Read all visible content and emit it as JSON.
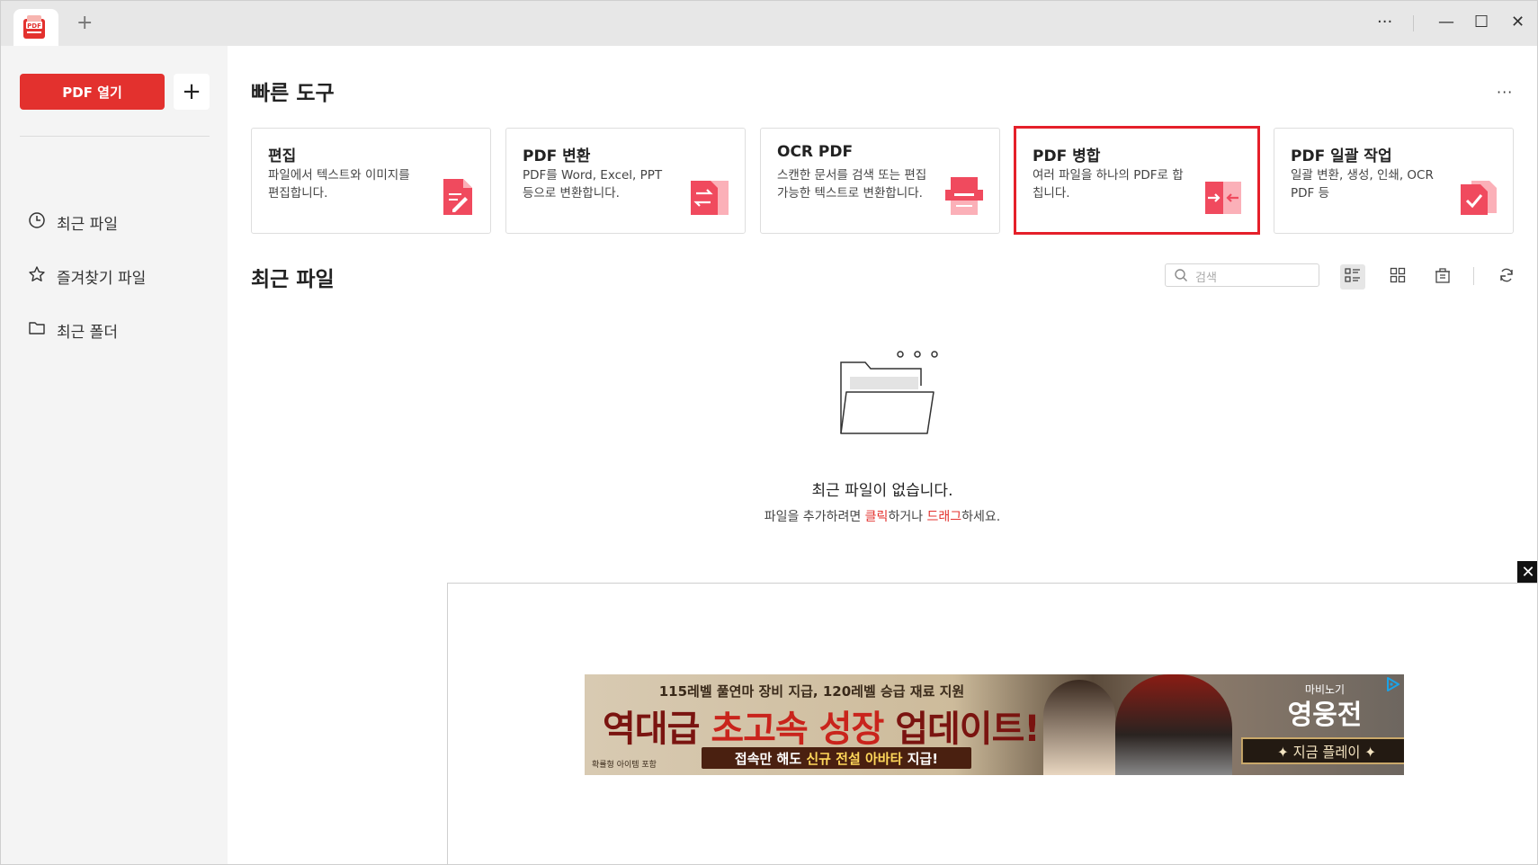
{
  "titlebar": {
    "new_tab": "+",
    "more": "···",
    "minimize": "—",
    "maximize": "☐",
    "close": "✕",
    "logo_text": "PDF"
  },
  "sidebar": {
    "open_button": "PDF 열기",
    "add_button": "+",
    "items": [
      {
        "label": "최근 파일",
        "icon": "clock-icon"
      },
      {
        "label": "즐겨찾기 파일",
        "icon": "star-icon"
      },
      {
        "label": "최근 폴더",
        "icon": "folder-icon"
      }
    ]
  },
  "quick_tools": {
    "title": "빠른 도구",
    "more": "···",
    "cards": [
      {
        "title": "편집",
        "desc": "파일에서 텍스트와 이미지를 편집합니다.",
        "icon": "edit-doc-icon"
      },
      {
        "title": "PDF 변환",
        "desc": "PDF를 Word, Excel, PPT 등으로 변환합니다.",
        "icon": "convert-icon"
      },
      {
        "title": "OCR PDF",
        "desc": "스캔한 문서를 검색 또는 편집 가능한 텍스트로 변환합니다.",
        "icon": "ocr-scan-icon"
      },
      {
        "title": "PDF 병합",
        "desc": "여러 파일을 하나의 PDF로 합칩니다.",
        "icon": "merge-icon"
      },
      {
        "title": "PDF 일괄 작업",
        "desc": "일괄 변환, 생성, 인쇄, OCR PDF 등",
        "icon": "batch-check-icon"
      }
    ],
    "highlighted_index": 3,
    "highlight_color": "#e5202a"
  },
  "recent": {
    "title": "최근 파일",
    "search_placeholder": "검색",
    "empty_title": "최근 파일이 없습니다.",
    "empty_sub_prefix": "파일을 추가하려면 ",
    "empty_click": "클릭",
    "empty_mid": "하거나 ",
    "empty_drag": "드래그",
    "empty_suffix": "하세요."
  },
  "ad": {
    "close": "✕",
    "top_line": "115레벨 풀연마 장비 지급, 120레벨 승급 재료 지원",
    "headline_a": "역대급 ",
    "headline_b": "초고속 성장",
    "headline_c": " 업데이트!",
    "sub_a": "접속만 해도 ",
    "sub_b": "신규 전설 아바타",
    "sub_c": " 지급!",
    "tiny": "확률형 아이템 포함",
    "brand_small": "마비노기",
    "brand": "영웅전",
    "cta": "✦  지금 플레이  ✦"
  },
  "colors": {
    "accent": "#e3312e",
    "icon_pink": "#f04a5e",
    "sidebar_bg": "#f4f4f4",
    "titlebar_bg": "#e7e7e7"
  }
}
